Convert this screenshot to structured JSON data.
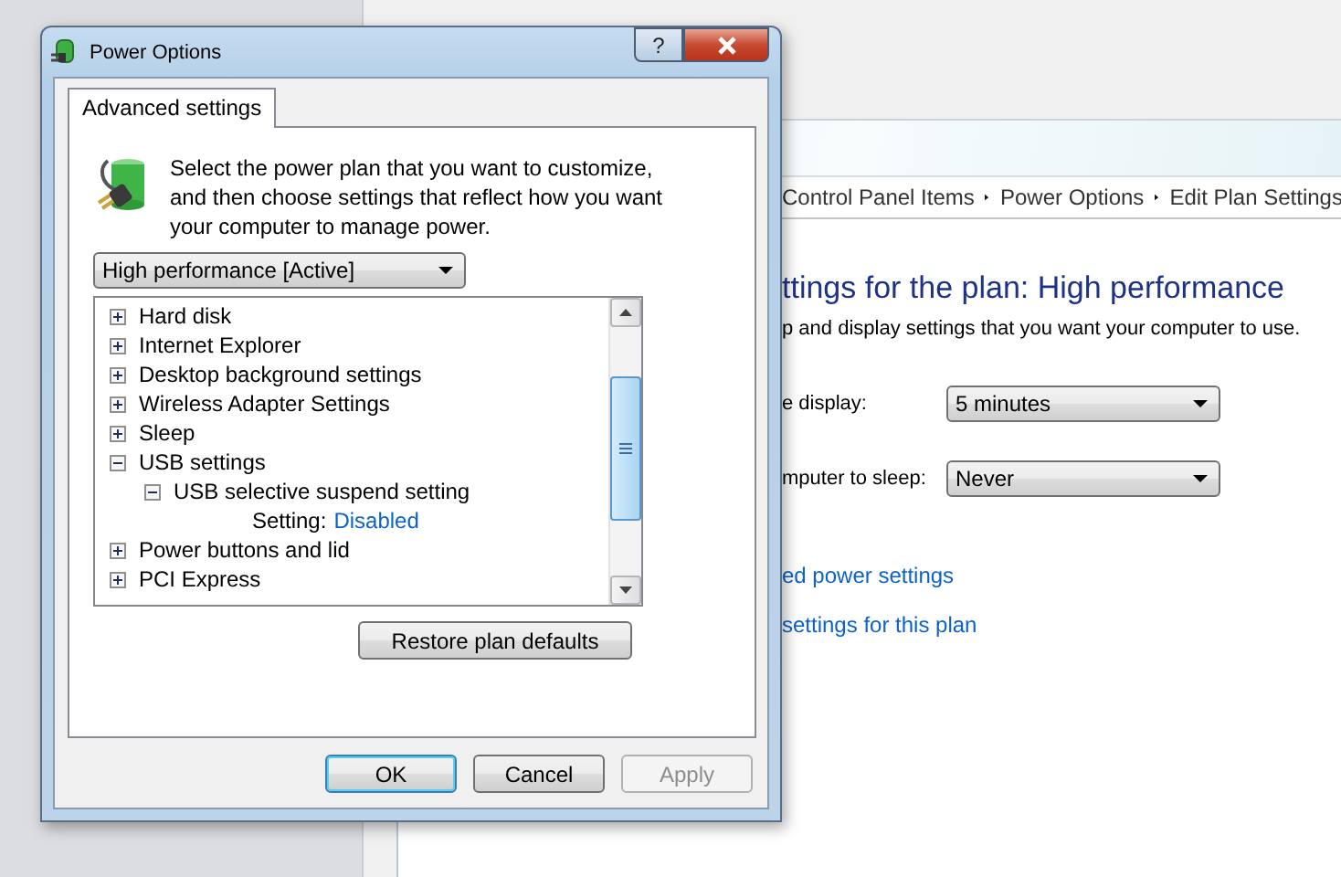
{
  "background_window": {
    "breadcrumb": [
      "Control Panel Items",
      "Power Options",
      "Edit Plan Settings"
    ],
    "heading": "ttings for the plan: High performance",
    "description": "p and display settings that you want your computer to use.",
    "settings": [
      {
        "label": "e display:",
        "value": "5 minutes"
      },
      {
        "label": "mputer to sleep:",
        "value": "Never"
      }
    ],
    "links": [
      "ed power settings",
      "settings for this plan"
    ]
  },
  "dialog": {
    "title": "Power Options",
    "help_button": "?",
    "tabs": [
      {
        "label": "Advanced settings",
        "selected": true
      }
    ],
    "intro": "Select the power plan that you want to customize, and then choose settings that reflect how you want your computer to manage power.",
    "plan_select": {
      "value": "High performance [Active]"
    },
    "tree": [
      {
        "kind": "node",
        "label": "Hard disk",
        "expanded": false
      },
      {
        "kind": "node",
        "label": "Internet Explorer",
        "expanded": false
      },
      {
        "kind": "node",
        "label": "Desktop background settings",
        "expanded": false
      },
      {
        "kind": "node",
        "label": "Wireless Adapter Settings",
        "expanded": false
      },
      {
        "kind": "node",
        "label": "Sleep",
        "expanded": false
      },
      {
        "kind": "node",
        "label": "USB settings",
        "expanded": true,
        "children": [
          {
            "kind": "node",
            "label": "USB selective suspend setting",
            "expanded": true,
            "children": [
              {
                "kind": "setting",
                "label": "Setting:",
                "value": "Disabled"
              }
            ]
          }
        ]
      },
      {
        "kind": "node",
        "label": "Power buttons and lid",
        "expanded": false
      },
      {
        "kind": "node",
        "label": "PCI Express",
        "expanded": false
      }
    ],
    "restore_button": "Restore plan defaults",
    "buttons": [
      {
        "label": "OK",
        "default": true,
        "disabled": false
      },
      {
        "label": "Cancel",
        "default": false,
        "disabled": false
      },
      {
        "label": "Apply",
        "default": false,
        "disabled": true
      }
    ]
  }
}
